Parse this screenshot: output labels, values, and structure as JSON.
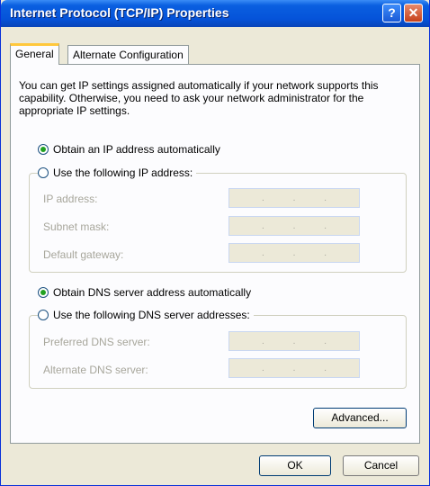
{
  "window": {
    "title": "Internet Protocol (TCP/IP) Properties",
    "help_glyph": "?",
    "close_glyph": "✕"
  },
  "tabs": [
    "General",
    "Alternate Configuration"
  ],
  "intro": "You can get IP settings assigned automatically if your network supports this capability. Otherwise, you need to ask your network administrator for the appropriate IP settings.",
  "ip": {
    "auto_label": "Obtain an IP address automatically",
    "manual_label": "Use the following IP address:",
    "auto_selected": true,
    "fields": [
      {
        "label": "IP address:"
      },
      {
        "label": "Subnet mask:"
      },
      {
        "label": "Default gateway:"
      }
    ]
  },
  "dns": {
    "auto_label": "Obtain DNS server address automatically",
    "manual_label": "Use the following DNS server addresses:",
    "auto_selected": true,
    "fields": [
      {
        "label": "Preferred DNS server:"
      },
      {
        "label": "Alternate DNS server:"
      }
    ]
  },
  "buttons": {
    "advanced": "Advanced...",
    "ok": "OK",
    "cancel": "Cancel"
  },
  "ip_dots": [
    ".",
    ".",
    "."
  ]
}
